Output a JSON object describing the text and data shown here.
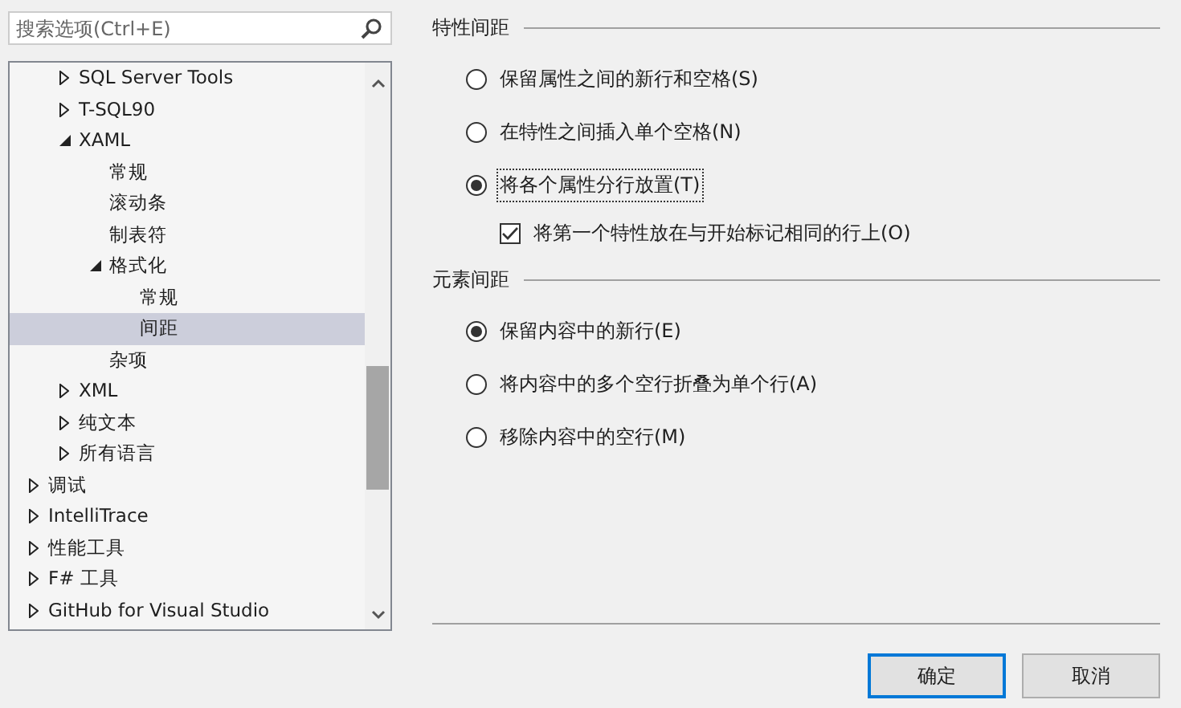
{
  "search": {
    "placeholder": "搜索选项(Ctrl+E)"
  },
  "tree": {
    "items": [
      {
        "children": [
          {
            "label": "SQL Server Tools",
            "expanded": false,
            "selected": false
          },
          {
            "label": "T-SQL90",
            "expanded": false,
            "selected": false
          },
          {
            "label": "XAML",
            "expanded": true,
            "selected": false,
            "children": [
              {
                "label": "常规",
                "selected": false
              },
              {
                "label": "滚动条",
                "selected": false
              },
              {
                "label": "制表符",
                "selected": false
              },
              {
                "label": "格式化",
                "expanded": true,
                "selected": false,
                "children": [
                  {
                    "label": "常规",
                    "selected": false
                  },
                  {
                    "label": "间距",
                    "selected": true
                  }
                ]
              },
              {
                "label": "杂项",
                "selected": false
              }
            ]
          },
          {
            "label": "XML",
            "expanded": false,
            "selected": false
          },
          {
            "label": "纯文本",
            "expanded": false,
            "selected": false
          },
          {
            "label": "所有语言",
            "expanded": false,
            "selected": false
          }
        ]
      },
      {
        "label": "调试",
        "expanded": false,
        "selected": false
      },
      {
        "label": "IntelliTrace",
        "expanded": false,
        "selected": false
      },
      {
        "label": "性能工具",
        "expanded": false,
        "selected": false
      },
      {
        "label": "F# 工具",
        "expanded": false,
        "selected": false
      },
      {
        "label": "GitHub for Visual Studio",
        "expanded": false,
        "selected": false
      }
    ]
  },
  "groups": [
    {
      "title": "特性间距",
      "options": [
        {
          "kind": "radio",
          "label": "保留属性之间的新行和空格(S)",
          "selected": false,
          "focused": false
        },
        {
          "kind": "radio",
          "label": "在特性之间插入单个空格(N)",
          "selected": false,
          "focused": false
        },
        {
          "kind": "radio",
          "label": "将各个属性分行放置(T)",
          "selected": true,
          "focused": true
        },
        {
          "kind": "checkbox",
          "label": "将第一个特性放在与开始标记相同的行上(O)",
          "checked": true,
          "focused": false
        }
      ]
    },
    {
      "title": "元素间距",
      "options": [
        {
          "kind": "radio",
          "label": "保留内容中的新行(E)",
          "selected": true,
          "focused": false
        },
        {
          "kind": "radio",
          "label": "将内容中的多个空行折叠为单个行(A)",
          "selected": false,
          "focused": false
        },
        {
          "kind": "radio",
          "label": "移除内容中的空行(M)",
          "selected": false,
          "focused": false
        }
      ]
    }
  ],
  "buttons": [
    {
      "label": "确定",
      "default": true
    },
    {
      "label": "取消",
      "default": false
    }
  ]
}
